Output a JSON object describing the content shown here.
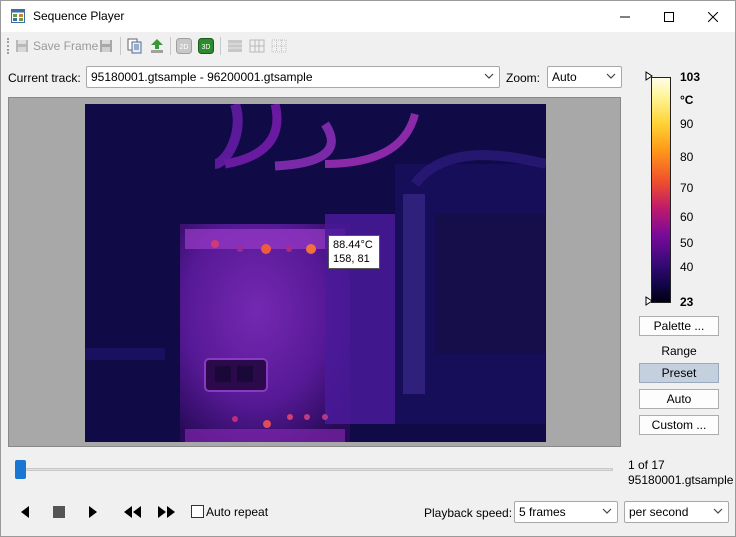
{
  "window": {
    "title": "Sequence Player"
  },
  "toolbar": {
    "save_frame_label": "Save Frame",
    "icons": [
      "save-frame-icon",
      "save-icon",
      "copy-icon",
      "export-icon",
      "2d-icon",
      "3d-icon",
      "layout-single-icon",
      "layout-grid-icon",
      "layout-dots-icon"
    ],
    "two_d_label": "2D",
    "three_d_label": "3D"
  },
  "track": {
    "label": "Current track:",
    "value": "95180001.gtsample - 96200001.gtsample"
  },
  "zoom": {
    "label": "Zoom:",
    "value": "Auto"
  },
  "thermal_image": {
    "readout_temperature": "88.44°C",
    "readout_position": "158, 81"
  },
  "scale": {
    "max": "103",
    "unit": "°C",
    "ticks": [
      "90",
      "80",
      "70",
      "60",
      "50",
      "40"
    ],
    "min": "23"
  },
  "side_buttons": {
    "palette": "Palette ...",
    "range_label": "Range",
    "preset": "Preset",
    "auto": "Auto",
    "custom": "Custom ..."
  },
  "playback": {
    "frame_counter": "1 of 17",
    "frame_file": "95180001.gtsample",
    "auto_repeat_label": "Auto repeat",
    "auto_repeat_checked": false,
    "speed_label": "Playback speed:",
    "speed_value": "5 frames",
    "speed_unit": "per second",
    "position": 0
  },
  "colors": {
    "accent": "#1976d2",
    "preset_active": "#c4d0dd"
  }
}
